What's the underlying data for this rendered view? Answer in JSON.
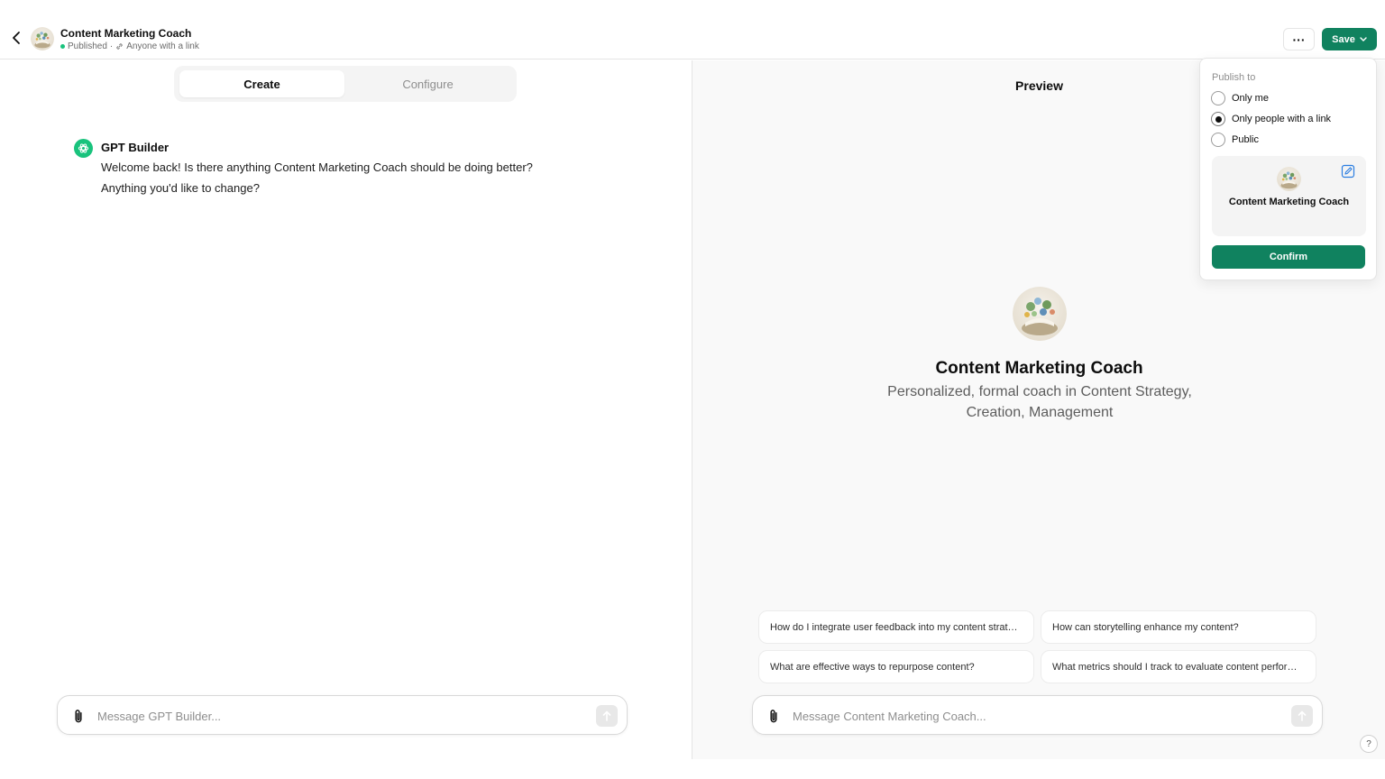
{
  "header": {
    "title": "Content Marketing Coach",
    "status": "Published",
    "separator": "·",
    "visibility": "Anyone with a link",
    "more_label": "···",
    "save_label": "Save"
  },
  "tabs": {
    "create": "Create",
    "configure": "Configure"
  },
  "builder": {
    "name": "GPT Builder",
    "message_line1": "Welcome back! Is there anything Content Marketing Coach should be doing better?",
    "message_line2": "Anything you'd like to change?"
  },
  "left_composer": {
    "placeholder": "Message GPT Builder..."
  },
  "preview": {
    "title": "Preview",
    "gpt_name": "Content Marketing Coach",
    "gpt_description": "Personalized, formal coach in Content Strategy, Creation, Management",
    "suggestions": [
      "How do I integrate user feedback into my content strategy?",
      "How can storytelling enhance my content?",
      "What are effective ways to repurpose content?",
      "What metrics should I track to evaluate content performance?"
    ],
    "composer_placeholder": "Message Content Marketing Coach...",
    "help_label": "?"
  },
  "publish": {
    "label": "Publish to",
    "options": [
      "Only me",
      "Only people with a link",
      "Public"
    ],
    "selected_index": 1,
    "card_name": "Content Marketing Coach",
    "confirm_label": "Confirm"
  },
  "colors": {
    "accent": "#10825f",
    "status_dot": "#19c37d",
    "builder_icon": "#19c37d",
    "edit_icon": "#2a7de1"
  }
}
